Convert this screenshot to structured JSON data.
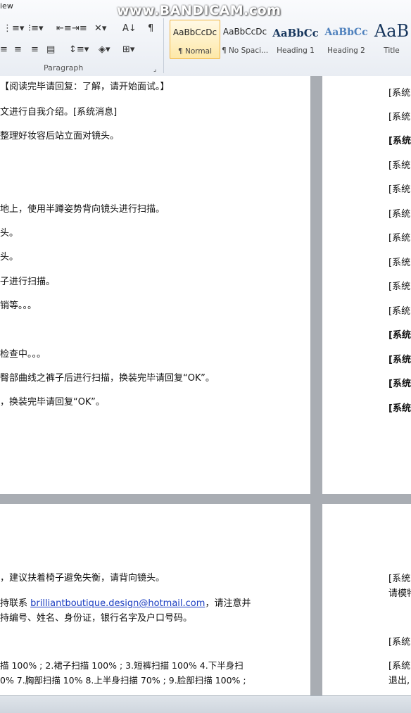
{
  "ribbon": {
    "tab_fragment": "iew",
    "watermark": "www.BANDICAM.com",
    "paragraph_label": "Paragraph",
    "styles": [
      {
        "preview": "AaBbCcDc",
        "name": "¶ Normal"
      },
      {
        "preview": "AaBbCcDc",
        "name": "¶ No Spaci..."
      },
      {
        "preview": "AaBbCc",
        "name": "Heading 1"
      },
      {
        "preview": "AaBbCc",
        "name": "Heading 2"
      },
      {
        "preview": "AaB",
        "name": "Title"
      }
    ]
  },
  "page_top_left": {
    "lines": [
      "【阅读完毕请回复：了解，请开始面试。】",
      "文进行自我介绍。[系统消息]",
      "整理好妆容后站立面对镜头。",
      "地上，使用半蹲姿势背向镜头进行扫描。",
      "头。",
      "头。",
      "子进行扫描。",
      "销等。。。",
      "检查中。。。",
      "臀部曲线之裤子后进行扫描，换装完毕请回复“OK”。",
      "，换装完毕请回复“OK”。"
    ]
  },
  "page_top_right": {
    "lines": [
      "[系统",
      "[系统",
      "[系统",
      "[系统",
      "[系统",
      "[系统",
      "[系统",
      "[系统",
      "[系统",
      "[系统",
      "[系统",
      "[系统",
      "[系统",
      "[系统"
    ]
  },
  "page_bottom_left": {
    "line1": "，建议扶着椅子避免失衡，请背向镜头。",
    "contact_prefix": "持联系 ",
    "email": "brilliantboutique.design@hotmail.com",
    "contact_suffix": "，请注意并",
    "line3": "持编号、姓名、身份证，银行名字及户口号码。",
    "scan1": "描  100% ; 2.裙子扫描  100% ; 3.短裤扫描  100% 4.下半身扫",
    "scan2": "0% 7.胸部扫描 10% 8.上半身扫描  70% ; 9.脸部扫描  100% ;"
  },
  "page_bottom_right": {
    "l1": "[系统",
    "l2": "请模特",
    "l3": "[系统",
    "l4": "[系统",
    "l5": "退出,"
  }
}
